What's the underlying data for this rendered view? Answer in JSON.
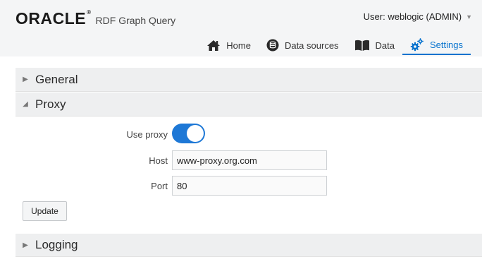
{
  "header": {
    "logo": "ORACLE",
    "logo_mark": "®",
    "app_title": "RDF Graph Query",
    "user_label": "User: weblogic (ADMIN)"
  },
  "nav": {
    "home": "Home",
    "data_sources": "Data sources",
    "data": "Data",
    "settings": "Settings",
    "active": "settings"
  },
  "sections": {
    "general": "General",
    "proxy": "Proxy",
    "logging": "Logging"
  },
  "proxy": {
    "use_proxy_label": "Use proxy",
    "use_proxy_enabled": true,
    "host_label": "Host",
    "host_value": "www-proxy.org.com",
    "port_label": "Port",
    "port_value": "80",
    "update_label": "Update"
  },
  "icons": {
    "home": "home-icon",
    "data_sources": "database-icon",
    "data": "book-icon",
    "settings": "gears-icon",
    "user_menu": "caret-down-icon"
  },
  "colors": {
    "accent": "#0572ce",
    "toggle_on": "#1e78d6",
    "header_bg": "#f4f5f6",
    "panel_bg": "#eeeff0"
  }
}
